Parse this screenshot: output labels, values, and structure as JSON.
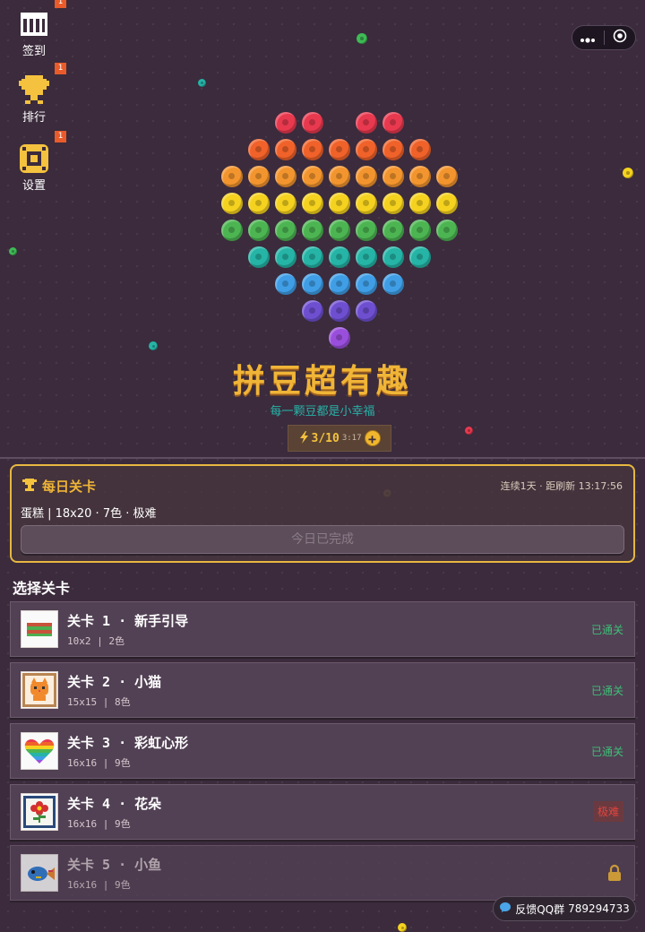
{
  "menu": [
    {
      "label": "签到",
      "badge": "1",
      "icon": "calendar-icon"
    },
    {
      "label": "排行",
      "badge": "1",
      "icon": "trophy-icon"
    },
    {
      "label": "设置",
      "badge": "1",
      "icon": "gear-icon"
    }
  ],
  "capsule": {
    "more_icon": "more-dots-icon",
    "close_icon": "target-icon"
  },
  "hero": {
    "bead_palette": [
      "#e8394f",
      "#f0622a",
      "#f3952e",
      "#f5d21f",
      "#4cb552",
      "#25b4a6",
      "#3f9ee6",
      "#6e4fd0",
      "#9a4fdc"
    ],
    "title": "拼豆超有趣",
    "subtitle": "每一颗豆都是小幸福"
  },
  "energy": {
    "icon": "lightning-icon",
    "value": "3/10",
    "timer": "3:17",
    "plus_label": "+"
  },
  "daily": {
    "title": "每日关卡",
    "icon": "trophy-icon",
    "streak": "连续1天 · 距刷新 13:17:56",
    "info": "蛋糕  |  18x20 · 7色 · 极难",
    "button_label": "今日已完成"
  },
  "section_title": "选择关卡",
  "levels": [
    {
      "name": "关卡 1 · 新手引导",
      "meta": "10x2  |  2色",
      "status": "已通关",
      "thumb_icon": "stripes-thumbnail",
      "locked": false
    },
    {
      "name": "关卡 2 · 小猫",
      "meta": "15x15  |  8色",
      "status": "已通关",
      "thumb_icon": "cat-thumbnail",
      "locked": false
    },
    {
      "name": "关卡 3 · 彩虹心形",
      "meta": "16x16  |  9色",
      "status": "已通关",
      "thumb_icon": "rainbow-heart-thumbnail",
      "locked": false
    },
    {
      "name": "关卡 4 · 花朵",
      "meta": "16x16  |  9色",
      "status": "极难",
      "thumb_icon": "flower-thumbnail",
      "locked": false
    },
    {
      "name": "关卡 5 · 小鱼",
      "meta": "16x16  |  9色",
      "status": "",
      "thumb_icon": "fish-thumbnail",
      "locked": true
    }
  ],
  "feedback": {
    "label": "反馈QQ群",
    "number": "789294733",
    "icon": "chat-bubble-icon"
  }
}
